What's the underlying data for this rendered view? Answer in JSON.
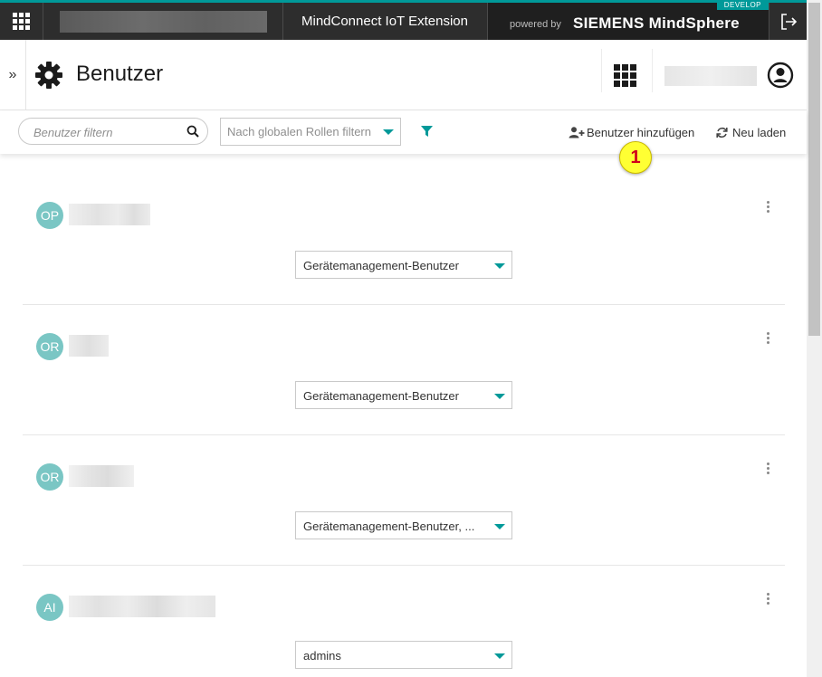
{
  "topbar": {
    "app_title": "MindConnect IoT Extension",
    "powered_by": "powered by",
    "brand": "SIEMENS MindSphere",
    "badge": "DEVELOP",
    "accent_color": "#009999"
  },
  "header": {
    "collapse_symbol": "»",
    "title": "Benutzer",
    "title_icon": "gear-icon",
    "apps_icon": "app-grid-icon",
    "user_icon": "user-account-icon"
  },
  "toolbar": {
    "search_placeholder": "Benutzer filtern",
    "role_filter_placeholder": "Nach globalen Rollen filtern",
    "add_user_label": "Benutzer hinzufügen",
    "reload_label": "Neu laden"
  },
  "callout": {
    "number": "1"
  },
  "users": [
    {
      "initials": "OP",
      "role": "Gerätemanagement-Benutzer"
    },
    {
      "initials": "OR",
      "role": "Gerätemanagement-Benutzer"
    },
    {
      "initials": "OR",
      "role": "Gerätemanagement-Benutzer, ..."
    },
    {
      "initials": "AI",
      "role": "admins"
    }
  ]
}
